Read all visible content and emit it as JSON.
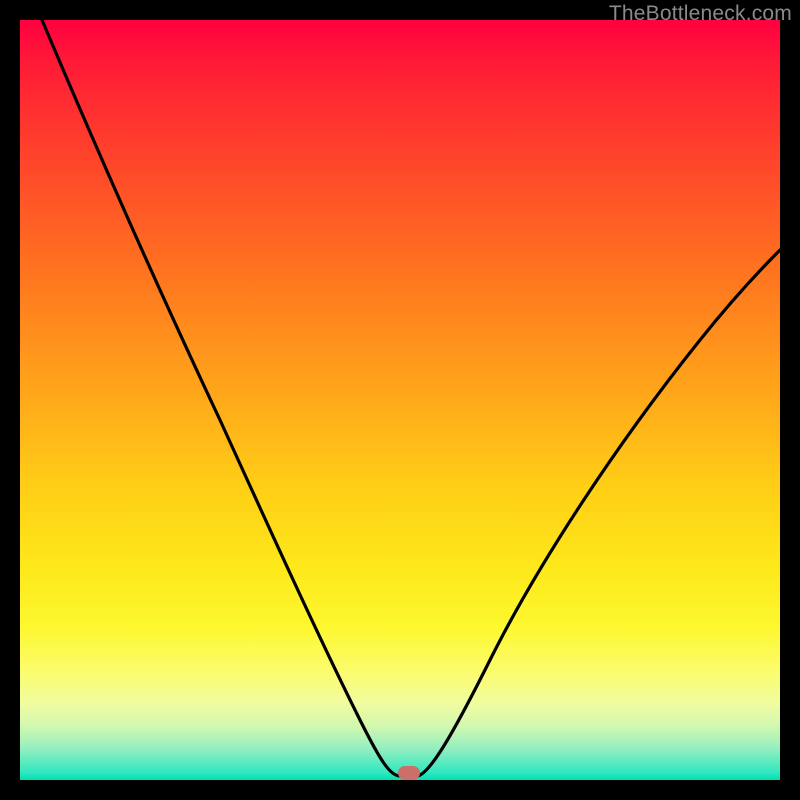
{
  "watermark": "TheBottleneck.com",
  "chart_data": {
    "type": "line",
    "title": "",
    "xlabel": "",
    "ylabel": "",
    "xlim": [
      0,
      100
    ],
    "ylim": [
      0,
      100
    ],
    "grid": false,
    "series": [
      {
        "name": "bottleneck-curve",
        "x": [
          3,
          8,
          15,
          22,
          30,
          38,
          42,
          45,
          47,
          49,
          51,
          53,
          55,
          60,
          68,
          78,
          90,
          100
        ],
        "y": [
          100,
          88,
          73,
          58,
          42,
          25,
          15,
          7,
          2,
          0,
          0,
          2,
          6,
          14,
          26,
          40,
          54,
          64
        ]
      }
    ],
    "marker": {
      "x": 50,
      "y": 0,
      "color": "#cc6e6a"
    },
    "gradient_stops": [
      {
        "pos": 0,
        "color": "#ff0040"
      },
      {
        "pos": 50,
        "color": "#ffb018"
      },
      {
        "pos": 80,
        "color": "#fdf830"
      },
      {
        "pos": 100,
        "color": "#00e0b0"
      }
    ]
  }
}
